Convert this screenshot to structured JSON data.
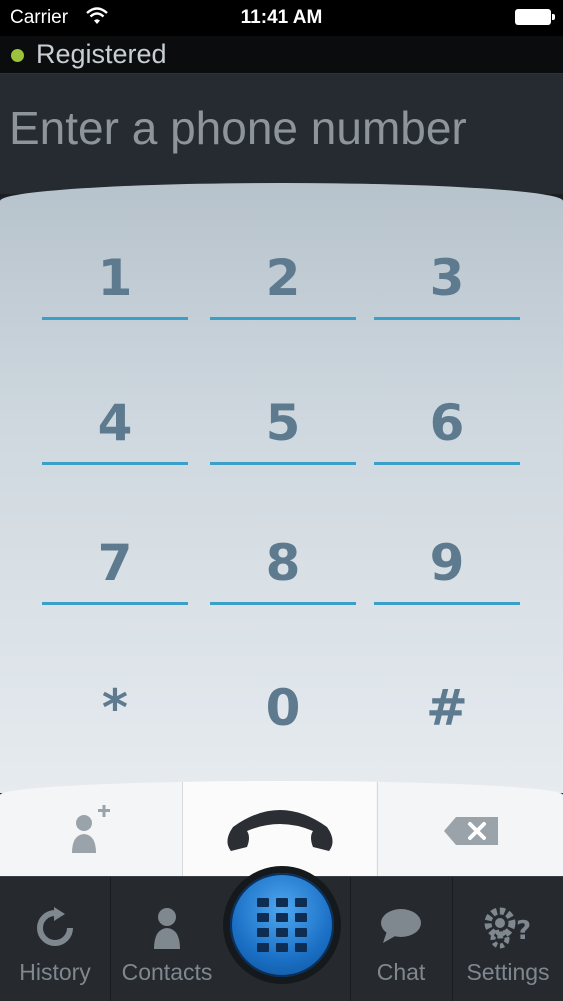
{
  "status_bar": {
    "carrier": "Carrier",
    "time": "11:41 AM"
  },
  "registration": {
    "label": "Registered",
    "status_color": "#9bc33b"
  },
  "number_field": {
    "placeholder": "Enter a phone number"
  },
  "keypad": {
    "keys": [
      "1",
      "2",
      "3",
      "4",
      "5",
      "6",
      "7",
      "8",
      "9",
      "*",
      "0",
      "#"
    ],
    "accent_color": "#3aa0c8"
  },
  "actions": {
    "add_contact_icon": "add-contact-icon",
    "call_icon": "phone-handset-icon",
    "backspace_icon": "backspace-icon"
  },
  "tabs": [
    {
      "label": "History",
      "icon": "refresh-icon"
    },
    {
      "label": "Contacts",
      "icon": "person-icon"
    },
    {
      "label": "",
      "icon": "keypad-icon"
    },
    {
      "label": "Chat",
      "icon": "chat-bubble-icon"
    },
    {
      "label": "Settings",
      "icon": "gears-question-icon"
    }
  ]
}
